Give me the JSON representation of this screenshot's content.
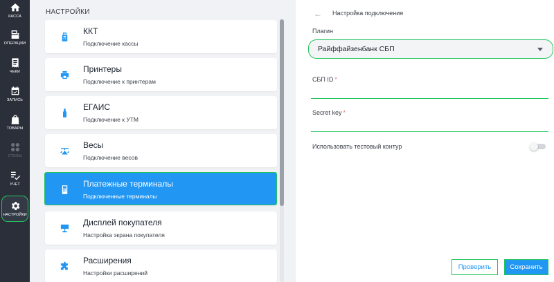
{
  "nav": {
    "items": [
      {
        "label": "КАССА",
        "icon": "home-icon"
      },
      {
        "label": "ОПЕРАЦИИ",
        "icon": "operations-icon"
      },
      {
        "label": "ЧЕКИ",
        "icon": "receipt-icon"
      },
      {
        "label": "ЗАПИСЬ",
        "icon": "calendar-check-icon"
      },
      {
        "label": "ТОВАРЫ",
        "icon": "shopping-bag-icon"
      },
      {
        "label": "СТОЛЫ",
        "icon": "tables-grid-icon"
      },
      {
        "label": "УЧЕТ",
        "icon": "checklist-icon"
      },
      {
        "label": "НАСТРОЙКИ",
        "icon": "gear-icon"
      }
    ]
  },
  "settings": {
    "title": "НАСТРОЙКИ",
    "cards": [
      {
        "title": "ККТ",
        "subtitle": "Подключение кассы",
        "icon": "cash-register-icon"
      },
      {
        "title": "Принтеры",
        "subtitle": "Подключение к принтерам",
        "icon": "printer-icon"
      },
      {
        "title": "ЕГАИС",
        "subtitle": "Подключение к УТМ",
        "icon": "bottle-icon"
      },
      {
        "title": "Весы",
        "subtitle": "Подключение весов",
        "icon": "scales-icon"
      },
      {
        "title": "Платежные терминалы",
        "subtitle": "Подключенные терминалы",
        "icon": "payment-terminal-icon"
      },
      {
        "title": "Дисплей покупателя",
        "subtitle": "Настройка экрана покупателя",
        "icon": "customer-display-icon"
      },
      {
        "title": "Расширения",
        "subtitle": "Настройки расширений",
        "icon": "puzzle-icon"
      }
    ]
  },
  "connection": {
    "back_icon": "←",
    "title": "Настройка подключения",
    "plugin_label": "Плагин",
    "plugin_value": "Райффайзенбанк СБП",
    "sbp_id_label": "СБП ID",
    "secret_key_label": "Secret key",
    "required_mark": "*",
    "test_mode_label": "Использовать тестовый контур",
    "check_button": "Проверить",
    "save_button": "Сохранить"
  },
  "colors": {
    "accent": "#2196f3",
    "highlight": "#22c55e",
    "nav_bg": "#2b2f3a"
  }
}
